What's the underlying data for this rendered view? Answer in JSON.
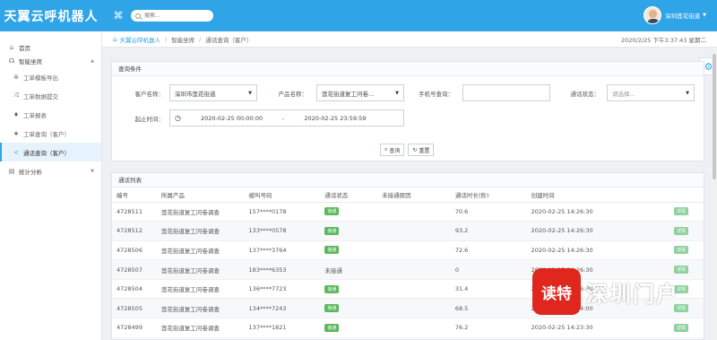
{
  "app": {
    "title": "天翼云呼机器人"
  },
  "search": {
    "placeholder": "搜索..."
  },
  "user": {
    "name": "深圳莲花街道"
  },
  "sidebar": {
    "items": [
      {
        "icon": "home-icon",
        "glyph": "⌂",
        "label": "首页"
      },
      {
        "icon": "headset-icon",
        "glyph": "☊",
        "label": "智能坐席"
      },
      {
        "icon": "export-icon",
        "glyph": "⊚",
        "label": "工单模板导出"
      },
      {
        "icon": "shuffle-icon",
        "glyph": "⤮",
        "label": "工单数据提交"
      },
      {
        "icon": "report-icon",
        "glyph": "♦",
        "label": "工单报表"
      },
      {
        "icon": "star-icon",
        "glyph": "★",
        "label": "工单查询（客户）"
      },
      {
        "icon": "share-icon",
        "glyph": "<",
        "label": "通话查询（客户）"
      },
      {
        "icon": "bar-chart-icon",
        "glyph": "▤",
        "label": "统计分析"
      }
    ]
  },
  "breadcrumb": {
    "home": "天翼云呼机器人",
    "section": "智能坐席",
    "current": "通话查询（客户）",
    "datetime": "2020/2/25 下午3:37:43 星期二"
  },
  "query": {
    "title": "查询条件",
    "customer_label": "客户名称：",
    "customer_value": "深圳市莲花街道",
    "product_label": "产品名称：",
    "product_value": "莲花街道复工问卷...",
    "phone_label": "手机号查询：",
    "status_label": "通话状态：",
    "status_placeholder": "请选择...",
    "time_label": "起止时间：",
    "start_time": "2020-02-25 00:00:00",
    "time_sep": "-",
    "end_time": "2020-02-25 23:59:59",
    "search_button": "查询",
    "reset_button": "重置"
  },
  "list": {
    "title": "通话列表",
    "columns": [
      "编号",
      "所属产品",
      "被叫号码",
      "通话状态",
      "未接通原因",
      "通话时长(秒)",
      "创建时间",
      ""
    ],
    "rows": [
      {
        "id": "4728511",
        "product": "莲花街道复工问卷调查",
        "phone": "157****0178",
        "status": "接通",
        "reason": "",
        "duration": "70.6",
        "created": "2020-02-25 14:26:30",
        "action": "详情"
      },
      {
        "id": "4728512",
        "product": "莲花街道复工问卷调查",
        "phone": "133****0578",
        "status": "接通",
        "reason": "",
        "duration": "93.2",
        "created": "2020-02-25 14:26:30",
        "action": "详情"
      },
      {
        "id": "4728506",
        "product": "莲花街道复工问卷调查",
        "phone": "137****3764",
        "status": "接通",
        "reason": "",
        "duration": "72.6",
        "created": "2020-02-25 14:26:30",
        "action": "详情"
      },
      {
        "id": "4728507",
        "product": "莲花街道复工问卷调查",
        "phone": "183****6353",
        "status": "未接通",
        "reason": "",
        "duration": "0",
        "created": "2020-02-25 14:26:30",
        "action": "详情"
      },
      {
        "id": "4728504",
        "product": "莲花街道复工问卷调查",
        "phone": "136****7723",
        "status": "接通",
        "reason": "",
        "duration": "31.4",
        "created": "2020-02-25 14:26:30",
        "action": "详情"
      },
      {
        "id": "4728505",
        "product": "莲花街道复工问卷调查",
        "phone": "134****7243",
        "status": "接通",
        "reason": "",
        "duration": "68.5",
        "created": "2020-02-25 14:24:00",
        "action": "详情"
      },
      {
        "id": "4728499",
        "product": "莲花街道复工问卷调查",
        "phone": "137****1821",
        "status": "接通",
        "reason": "",
        "duration": "76.2",
        "created": "2020-02-25 14:23:30",
        "action": "详情"
      }
    ]
  },
  "watermark": {
    "badge": "读特",
    "text": "深圳门户"
  },
  "colors": {
    "primary": "#2fa4e7",
    "success": "#5cb85c"
  }
}
